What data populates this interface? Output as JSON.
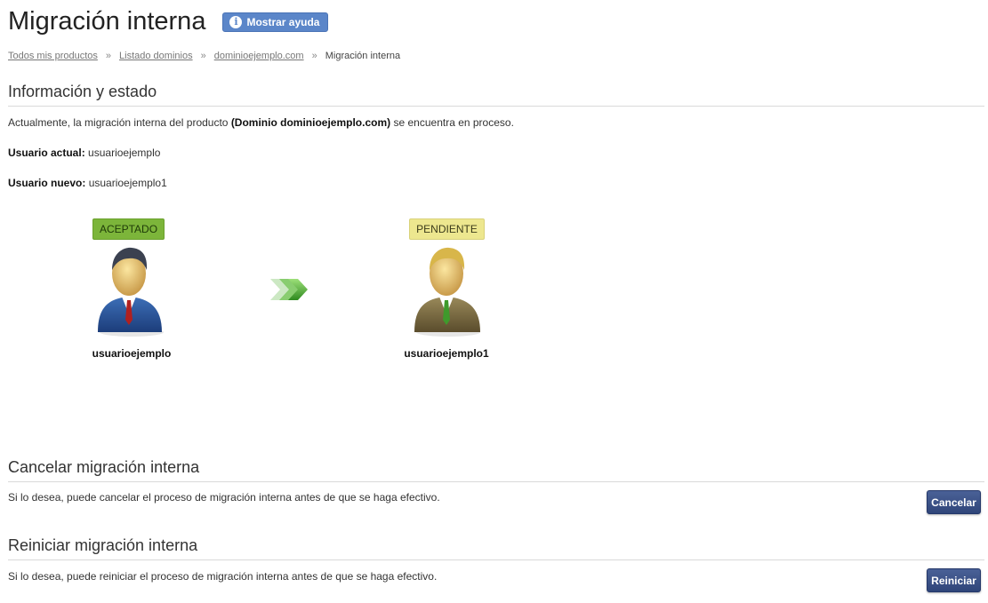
{
  "page": {
    "title": "Migración interna",
    "help_button": "Mostrar ayuda"
  },
  "breadcrumb": {
    "items": [
      "Todos mis productos",
      "Listado dominios",
      "dominioejemplo.com"
    ],
    "separator": "»",
    "current": "Migración interna"
  },
  "info": {
    "title": "Información y estado",
    "description_prefix": "Actualmente, la migración interna del producto ",
    "description_bold": "(Dominio dominioejemplo.com)",
    "description_suffix": " se encuentra en proceso.",
    "current_user_label": "Usuario actual:",
    "current_user_value": "usuarioejemplo",
    "new_user_label": "Usuario nuevo:",
    "new_user_value": "usuarioejemplo1"
  },
  "migration": {
    "from": {
      "status": "ACEPTADO",
      "status_color": "#7cb53a",
      "user": "usuarioejemplo",
      "icon": "user-avatar-blue-icon"
    },
    "arrow_icon": "forward-arrows-icon",
    "to": {
      "status": "PENDIENTE",
      "status_color": "#ede78f",
      "user": "usuarioejemplo1",
      "icon": "user-avatar-olive-icon"
    }
  },
  "cancel_section": {
    "title": "Cancelar migración interna",
    "text": "Si lo desea, puede cancelar el proceso de migración interna antes de que se haga efectivo.",
    "button": "Cancelar"
  },
  "restart_section": {
    "title": "Reiniciar migración interna",
    "text": "Si lo desea, puede reiniciar el proceso de migración interna antes de que se haga efectivo.",
    "button": "Reiniciar"
  },
  "colors": {
    "accent": "#5b86c9",
    "button": "#3a5088"
  }
}
